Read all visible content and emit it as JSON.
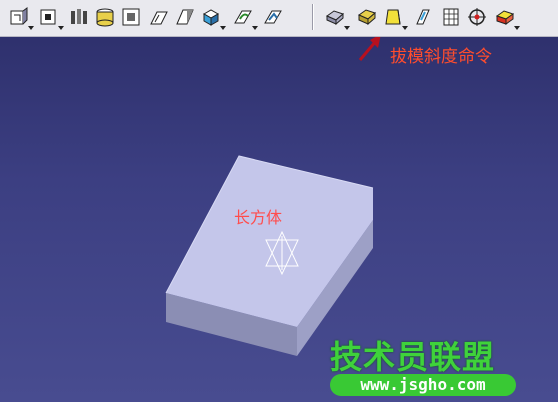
{
  "annotation": {
    "text": "拔模斜度命令"
  },
  "object_label": "长方体",
  "watermark": {
    "title": "技术员联盟",
    "url": "www.jsgho.com"
  },
  "toolbar": {
    "buttons": [
      {
        "name": "pad-icon",
        "has_menu": true
      },
      {
        "name": "pocket-icon",
        "has_menu": true
      },
      {
        "name": "shaft-icon",
        "has_menu": false
      },
      {
        "name": "hole-icon",
        "has_menu": false
      },
      {
        "name": "slot-icon",
        "has_menu": false
      },
      {
        "name": "rib-icon",
        "has_menu": false
      },
      {
        "name": "stiffener-icon",
        "has_menu": false
      },
      {
        "name": "multi-section-icon",
        "has_menu": true
      },
      {
        "name": "removed-section-icon",
        "has_menu": true
      },
      {
        "name": "solid-icon",
        "has_menu": false
      },
      {
        "name": "fillet-icon",
        "has_menu": false
      },
      {
        "name": "chamfer-icon",
        "has_menu": false
      },
      {
        "name": "draft-icon",
        "has_menu": true
      },
      {
        "name": "shell-icon",
        "has_menu": false
      },
      {
        "name": "thickness-icon",
        "has_menu": false
      },
      {
        "name": "thread-icon",
        "has_menu": false
      },
      {
        "name": "replace-face-icon",
        "has_menu": true
      }
    ]
  },
  "colors": {
    "background_top": "#2b2d68",
    "background_bottom": "#484c90",
    "box_top": "#c4c6ea",
    "box_front": "#8b8eb4",
    "box_side": "#a0a3c8",
    "annotation": "#ff4d2d",
    "watermark": "#3fd23b"
  }
}
